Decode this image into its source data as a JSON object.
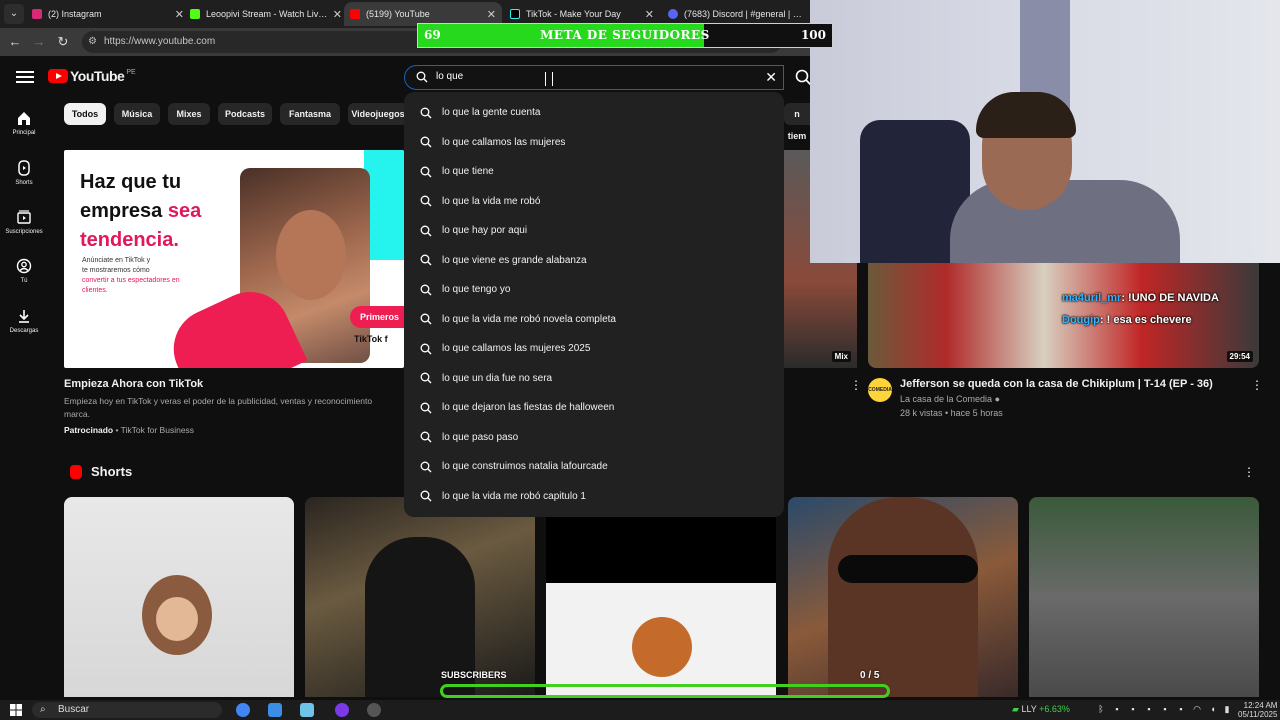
{
  "browser": {
    "tabs": [
      {
        "label": "(2) Instagram",
        "color": "#d62976"
      },
      {
        "label": "Leoopivi Stream - Watch Live o",
        "color": "#53fc18"
      },
      {
        "label": "(5199) YouTube",
        "color": "#ff0000"
      },
      {
        "label": "TikTok - Make Your Day",
        "color": "#000000"
      },
      {
        "label": "(7683) Discord | #general | LEO",
        "color": "#5865f2"
      }
    ],
    "url": "https://www.youtube.com"
  },
  "youtube": {
    "logo": "YouTube",
    "country": "PE",
    "search_value": "lo que",
    "sidebar": [
      "Principal",
      "Shorts",
      "Suscripciones",
      "Tú",
      "Descargas"
    ],
    "chips": [
      "Todos",
      "Música",
      "Mixes",
      "Podcasts",
      "Fantasma",
      "Videojuegos",
      "n tiem"
    ],
    "suggestions": [
      "lo que la gente cuenta",
      "lo que callamos las mujeres",
      "lo que tiene",
      "lo que la vida me robó",
      "lo que hay por aqui",
      "lo que viene es grande alabanza",
      "lo que tengo yo",
      "lo que la vida me robó novela completa",
      "lo que callamos las mujeres 2025",
      "lo que un dia fue no sera",
      "lo que dejaron las fiestas de halloween",
      "lo que paso paso",
      "lo que construimos natalia lafourcade",
      "lo que la vida me robó capitulo 1"
    ],
    "ad": {
      "headline_1": "Haz que tu",
      "headline_2": "empresa ",
      "headline_pink_1": "sea",
      "headline_pink_2": "tendencia.",
      "sub_1": "Anúnciate en TikTok y",
      "sub_2": "te mostraremos cómo",
      "sub_pink": "convertir a tus espectadores en clientes.",
      "cta": "Primeros",
      "brand": "TikTok f",
      "title": "Empieza Ahora con TikTok",
      "desc_1": "Empieza hoy en TikTok y veras el poder de la publicidad, ventas y reconocimiento",
      "desc_2": "marca.",
      "sponsored": "Patrocinado",
      "advertiser": " • TikTok for Business"
    },
    "video": {
      "title": "Jefferson se queda con la casa de Chikiplum | T-14 (EP - 36)",
      "channel": "La casa de la Comedia",
      "meta": "28 k vistas • hace 5 horas",
      "duration": "29:54",
      "avatar_text": "COMEDIA"
    },
    "mix_badge": "Mix",
    "shorts_label": "Shorts"
  },
  "overlay": {
    "goal_current": "69",
    "goal_label": "META DE SEGUIDORES",
    "goal_target": "100",
    "goal_fraction": 0.69,
    "chat": [
      {
        "user": "ma4uril_mr",
        "msg": ": !UNO DE NAVIDA"
      },
      {
        "user": "Dougip",
        "msg": ": ! esa es chevere"
      }
    ],
    "subs_label": "SUBSCRIBERS",
    "subs_count": "0 / 5"
  },
  "taskbar": {
    "search": "Buscar",
    "stock_name": "LLY",
    "stock_change": "+6.63%",
    "time": "12:24 AM",
    "date": "05/11/2025"
  }
}
